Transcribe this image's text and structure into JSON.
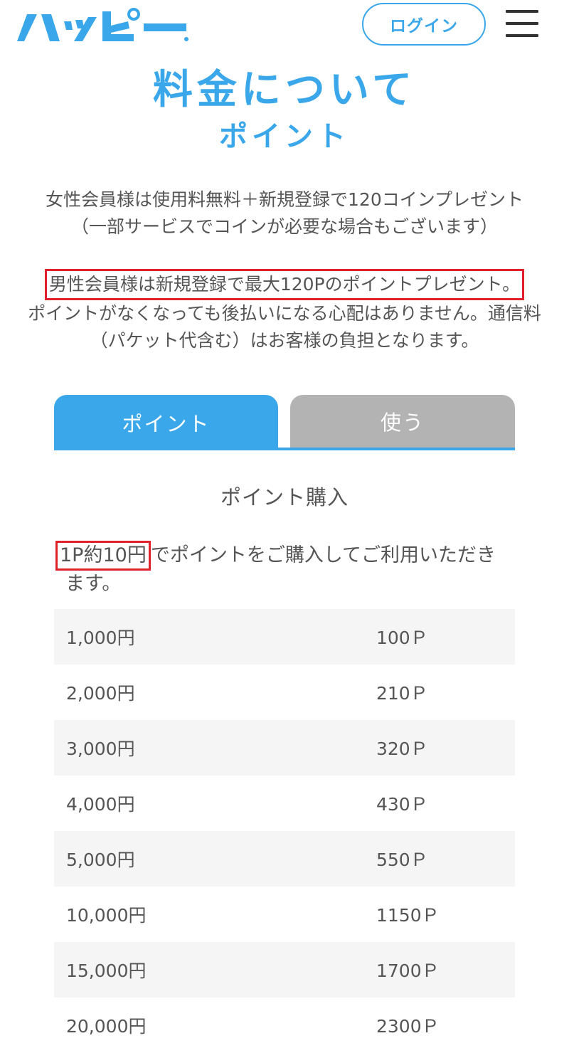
{
  "header": {
    "logo_text": "ハッピー",
    "login_label": "ログイン"
  },
  "page": {
    "title": "料金について",
    "subtitle": "ポイント"
  },
  "intro": {
    "female_text": "女性会員様は使用料無料＋新規登録で120コインプレゼント（一部サービスでコインが必要な場合もございます）",
    "male_highlight": "男性会員様は新規登録で最大120Pのポイントプレゼント。",
    "male_rest": "ポイントがなくなっても後払いになる心配はありません。通信料（パケット代含む）はお客様の負担となります。"
  },
  "tabs": [
    {
      "label": "ポイント"
    },
    {
      "label": "使う"
    }
  ],
  "purchase": {
    "title": "ポイント購入",
    "rate_highlight": "1P約10円",
    "rate_rest": "でポイントをご購入してご利用いただきます。"
  },
  "price_rows": [
    {
      "yen": "1,000円",
      "points": "100Ｐ"
    },
    {
      "yen": "2,000円",
      "points": "210Ｐ"
    },
    {
      "yen": "3,000円",
      "points": "320Ｐ"
    },
    {
      "yen": "4,000円",
      "points": "430Ｐ"
    },
    {
      "yen": "5,000円",
      "points": "550Ｐ"
    },
    {
      "yen": "10,000円",
      "points": "1150Ｐ"
    },
    {
      "yen": "15,000円",
      "points": "1700Ｐ"
    },
    {
      "yen": "20,000円",
      "points": "2300Ｐ"
    }
  ],
  "colors": {
    "brand_blue": "#3aa7ea",
    "tab_inactive": "#b3b3b3",
    "highlight_red": "#e0202a",
    "row_stripe": "#f5f5f5"
  }
}
